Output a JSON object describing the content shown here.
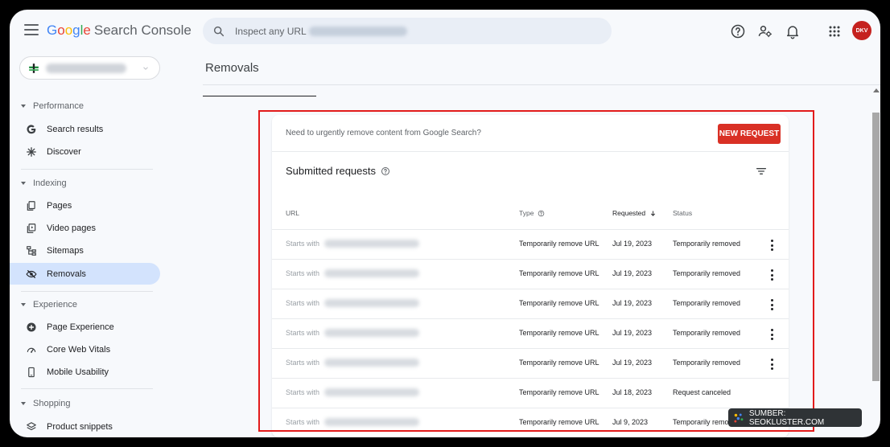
{
  "header": {
    "brand_google": "Google",
    "brand_product": "Search Console",
    "search_placeholder": "Inspect any URL i",
    "avatar_text": "DKV",
    "colors": {
      "blue": "#4285f4",
      "red": "#ea4335",
      "yellow": "#fbbc05",
      "green": "#34a853"
    }
  },
  "sidebar": {
    "sections": [
      {
        "title": "Performance",
        "items": [
          {
            "label": "Search results",
            "icon": "google-g-icon"
          },
          {
            "label": "Discover",
            "icon": "asterisk-icon"
          }
        ]
      },
      {
        "title": "Indexing",
        "items": [
          {
            "label": "Pages",
            "icon": "pages-icon"
          },
          {
            "label": "Video pages",
            "icon": "video-icon"
          },
          {
            "label": "Sitemaps",
            "icon": "sitemap-icon"
          },
          {
            "label": "Removals",
            "icon": "eye-off-icon",
            "active": true
          }
        ]
      },
      {
        "title": "Experience",
        "items": [
          {
            "label": "Page Experience",
            "icon": "plus-circle-icon"
          },
          {
            "label": "Core Web Vitals",
            "icon": "gauge-icon"
          },
          {
            "label": "Mobile Usability",
            "icon": "phone-icon"
          }
        ]
      },
      {
        "title": "Shopping",
        "items": [
          {
            "label": "Product snippets",
            "icon": "layers-icon"
          }
        ]
      }
    ]
  },
  "main": {
    "title": "Removals",
    "banner_text": "Need to urgently remove content from Google Search?",
    "new_request_label": "NEW REQUEST",
    "card_title": "Submitted requests",
    "columns": {
      "url": "URL",
      "type": "Type",
      "requested": "Requested",
      "status": "Status"
    },
    "rows": [
      {
        "url_prefix": "Starts with",
        "type": "Temporarily remove URL",
        "requested": "Jul 19, 2023",
        "status": "Temporarily removed",
        "menu": true
      },
      {
        "url_prefix": "Starts with",
        "type": "Temporarily remove URL",
        "requested": "Jul 19, 2023",
        "status": "Temporarily removed",
        "menu": true
      },
      {
        "url_prefix": "Starts with",
        "type": "Temporarily remove URL",
        "requested": "Jul 19, 2023",
        "status": "Temporarily removed",
        "menu": true
      },
      {
        "url_prefix": "Starts with",
        "type": "Temporarily remove URL",
        "requested": "Jul 19, 2023",
        "status": "Temporarily removed",
        "menu": true
      },
      {
        "url_prefix": "Starts with",
        "type": "Temporarily remove URL",
        "requested": "Jul 19, 2023",
        "status": "Temporarily removed",
        "menu": true
      },
      {
        "url_prefix": "Starts with",
        "type": "Temporarily remove URL",
        "requested": "Jul 18, 2023",
        "status": "Request canceled",
        "menu": false
      },
      {
        "url_prefix": "Starts with",
        "type": "Temporarily remove URL",
        "requested": "Jul 9, 2023",
        "status": "Temporarily remo",
        "menu": false
      }
    ]
  },
  "watermark": {
    "text": "SUMBER: SEOKLUSTER.COM"
  },
  "highlight_color": "#e21b1b"
}
